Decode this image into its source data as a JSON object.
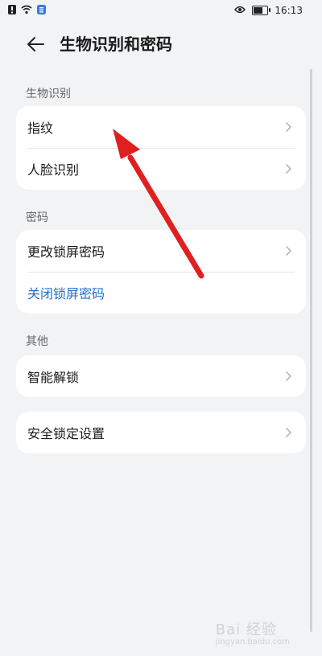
{
  "status_bar": {
    "time": "16:13"
  },
  "header": {
    "title": "生物识别和密码"
  },
  "sections": {
    "biometrics": {
      "label": "生物识别",
      "items": [
        "指纹",
        "人脸识别"
      ]
    },
    "password": {
      "label": "密码",
      "items": [
        "更改锁屏密码",
        "关闭锁屏密码"
      ]
    },
    "other": {
      "label": "其他",
      "items": [
        "智能解锁"
      ]
    },
    "security": {
      "items": [
        "安全锁定设置"
      ]
    }
  },
  "colors": {
    "link": "#1f6fd6",
    "arrow": "#e02020",
    "background": "#f1f3f5"
  },
  "watermark": {
    "main": "Bai 经验",
    "sub": "jingyan.baidu.com"
  }
}
